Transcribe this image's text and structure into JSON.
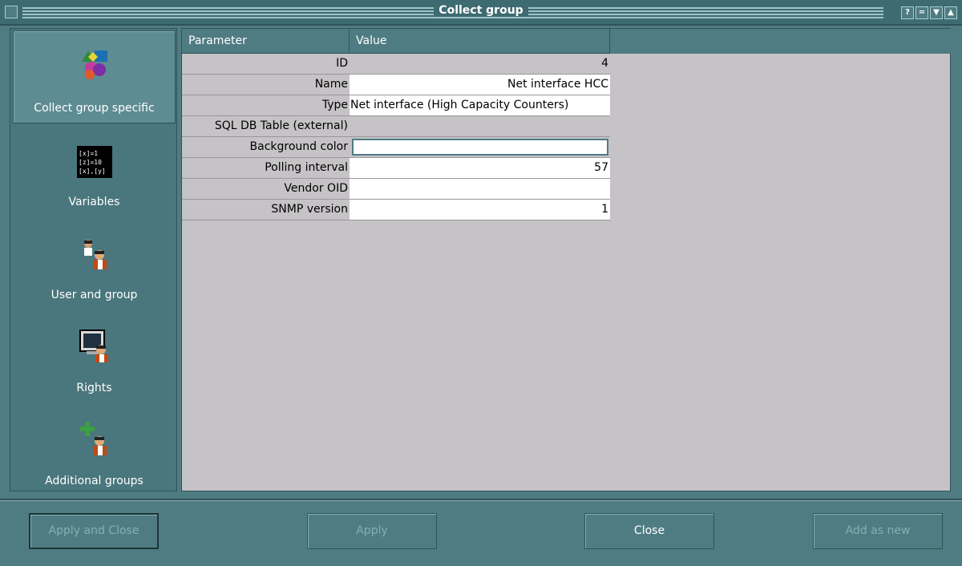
{
  "window": {
    "title": "Collect group",
    "buttons": [
      "?",
      "=",
      "▼",
      "▲"
    ]
  },
  "sidebar": {
    "items": [
      {
        "label": "Collect group specific",
        "icon": "shapes-icon",
        "active": true
      },
      {
        "label": "Variables",
        "icon": "variables-icon",
        "active": false
      },
      {
        "label": "User and group",
        "icon": "user-group-icon",
        "active": false
      },
      {
        "label": "Rights",
        "icon": "rights-icon",
        "active": false
      },
      {
        "label": "Additional groups",
        "icon": "add-group-icon",
        "active": false
      }
    ],
    "variables_icon_lines": [
      "[x]=1",
      "[z]=10",
      "[x],[y]"
    ]
  },
  "table": {
    "headers": {
      "parameter": "Parameter",
      "value": "Value"
    },
    "rows": [
      {
        "parameter": "ID",
        "value": "4"
      },
      {
        "parameter": "Name",
        "value": "Net interface HCC"
      },
      {
        "parameter": "Type",
        "value": "Net interface (High Capacity Counters)"
      },
      {
        "parameter": "SQL DB Table (external)",
        "value": ""
      },
      {
        "parameter": "Background color",
        "value": ""
      },
      {
        "parameter": "Polling interval",
        "value": "57"
      },
      {
        "parameter": "Vendor OID",
        "value": ""
      },
      {
        "parameter": "SNMP version",
        "value": "1"
      }
    ]
  },
  "buttons": {
    "apply_close": "Apply and Close",
    "apply": "Apply",
    "close": "Close",
    "add_as_new": "Add as new"
  }
}
